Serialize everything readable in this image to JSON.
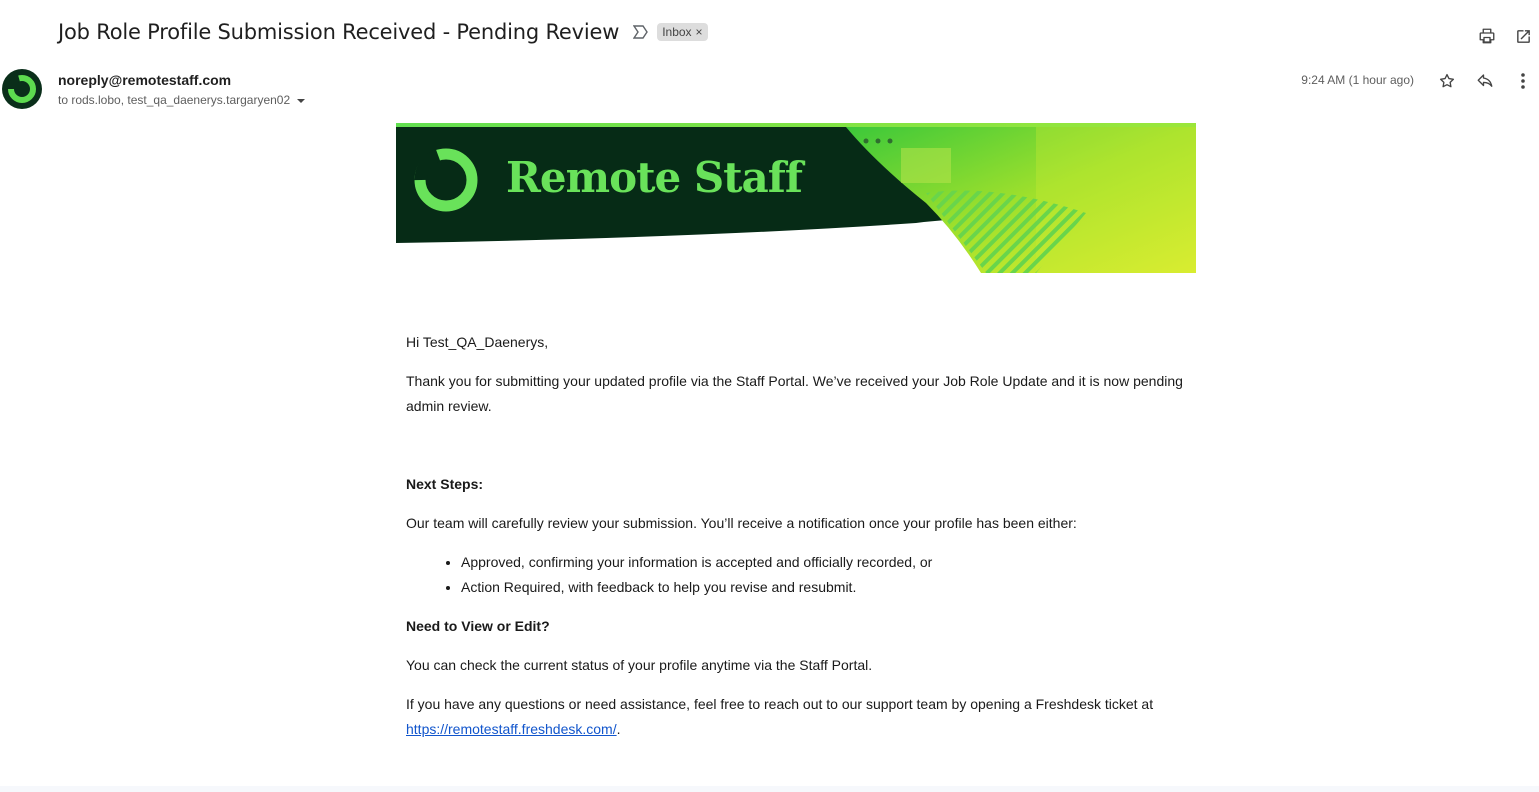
{
  "email": {
    "subject": "Job Role Profile Submission Received - Pending Review",
    "label": "Inbox",
    "label_remove": "×",
    "sender": "noreply@remotestaff.com",
    "recipients": "to rods.lobo, test_qa_daenerys.targaryen02",
    "timestamp": "9:24 AM (1 hour ago)"
  },
  "icons": {
    "importance": "importance-marker-icon",
    "print": "print-icon",
    "open_new_window": "open-in-new-window-icon",
    "star": "star-icon",
    "reply": "reply-icon",
    "more": "more-vertical-icon",
    "caret": "caret-down-icon"
  },
  "banner": {
    "brand": "Remote Staff"
  },
  "body": {
    "greeting": "Hi Test_QA_Daenerys,",
    "intro": "Thank you for submitting your updated profile via the Staff Portal. We’ve received your Job Role Update and it is now pending admin review.",
    "next_steps_heading": "Next Steps:",
    "next_steps_text": "Our team will carefully review your submission. You’ll receive a notification once your profile has been either:",
    "bullets": [
      "Approved, confirming your information is accepted and officially recorded, or",
      "Action Required, with feedback to help you revise and resubmit."
    ],
    "view_edit_heading": "Need to View or Edit?",
    "view_edit_text": "You can check the current status of your profile anytime via the Staff Portal.",
    "support_text": "If you have any questions or need assistance, feel free to reach out to our support team by opening a Freshdesk ticket at",
    "support_link": "https://remotestaff.freshdesk.com/",
    "support_end": "."
  },
  "colors": {
    "banner_dark": "#062b16",
    "banner_accent": "#69e25a",
    "banner_yellow": "#d9f23a",
    "link": "#1155cc"
  }
}
